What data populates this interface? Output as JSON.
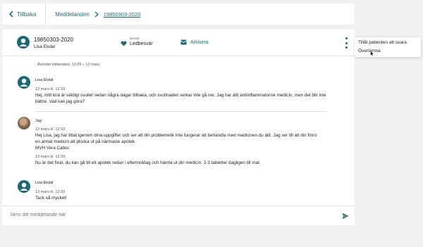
{
  "breadcrumb": {
    "back_label": "Tillbaka",
    "section_label": "Meddelanden",
    "current_label": "19850303-2020"
  },
  "header": {
    "patient_id": "19850303-2020",
    "patient_name": "Lisa Ekdal",
    "reason_label": "Besvär",
    "reason_value": "Ledbesvär",
    "archive_label": "Arkivera"
  },
  "system_note": "Ärendet initierades: 11:29 – 13 mars",
  "messages": [
    {
      "author": "Lisa Ekdal",
      "timestamp": "13 mars kl. 12:33",
      "lines": [
        "Hej, mitt knä är väldigt svullet sedan några dagar tillbaka, och svullnaden verkar inte gå ner. Jag har ätit antiinflammatorisk medicin, men det blir inte",
        "bättre. Vad kan jag göra?"
      ]
    },
    {
      "author": "Jag",
      "timestamp": "13 mars kl. 12:33",
      "lines": [
        "Hej Lisa, jag har tittat igenom dina uppgifter och ser att din problemetik inte fungerar att behandla med medicinen du ätit. Jag ser till att din finns",
        "en annat medicin att plocka ut på närmaste apotek.",
        "MVH Vera Cabisi"
      ],
      "timestamp2": "13 mars kl. 12:33",
      "line2": "Nu är det fixat, du kan gå till ett apotek redan i eftermiddag och hämta ut din medicin. 2-3 tabletter dagligen till mat."
    },
    {
      "author": "Lisa Ekdal",
      "timestamp": "13 mars kl. 12:33",
      "lines": [
        "Tack så mycket!"
      ]
    }
  ],
  "composer": {
    "placeholder": "Skriv ditt meddelande här"
  },
  "menu": {
    "items": [
      "Tillåt patienten att svara",
      "Överlämna"
    ]
  },
  "colors": {
    "accent": "#1b6a73",
    "background": "#f1f1f4"
  }
}
